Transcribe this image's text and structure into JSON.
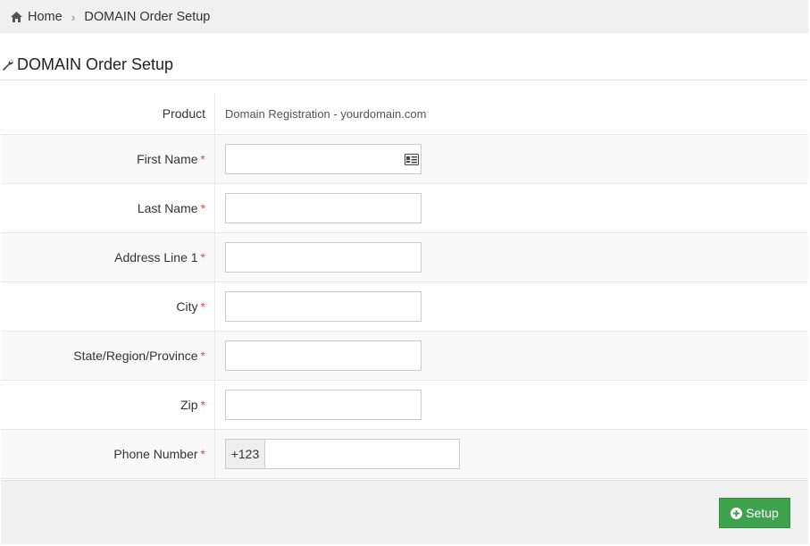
{
  "breadcrumb": {
    "home": "Home",
    "current": "DOMAIN Order Setup"
  },
  "page": {
    "title": "DOMAIN Order Setup"
  },
  "form": {
    "product_label": "Product",
    "product_value": "Domain Registration - yourdomain.com",
    "fields": [
      {
        "label": "First Name",
        "required": "*",
        "value": ""
      },
      {
        "label": "Last Name",
        "required": "*",
        "value": ""
      },
      {
        "label": "Address Line 1",
        "required": "*",
        "value": ""
      },
      {
        "label": "City",
        "required": "*",
        "value": ""
      },
      {
        "label": "State/Region/Province",
        "required": "*",
        "value": ""
      },
      {
        "label": "Zip",
        "required": "*",
        "value": ""
      }
    ],
    "phone": {
      "label": "Phone Number",
      "required": "*",
      "prefix": "+123",
      "value": ""
    }
  },
  "footer": {
    "setup_label": "Setup"
  },
  "colors": {
    "primary_button": "#3fa34d",
    "required": "#d9534f"
  }
}
